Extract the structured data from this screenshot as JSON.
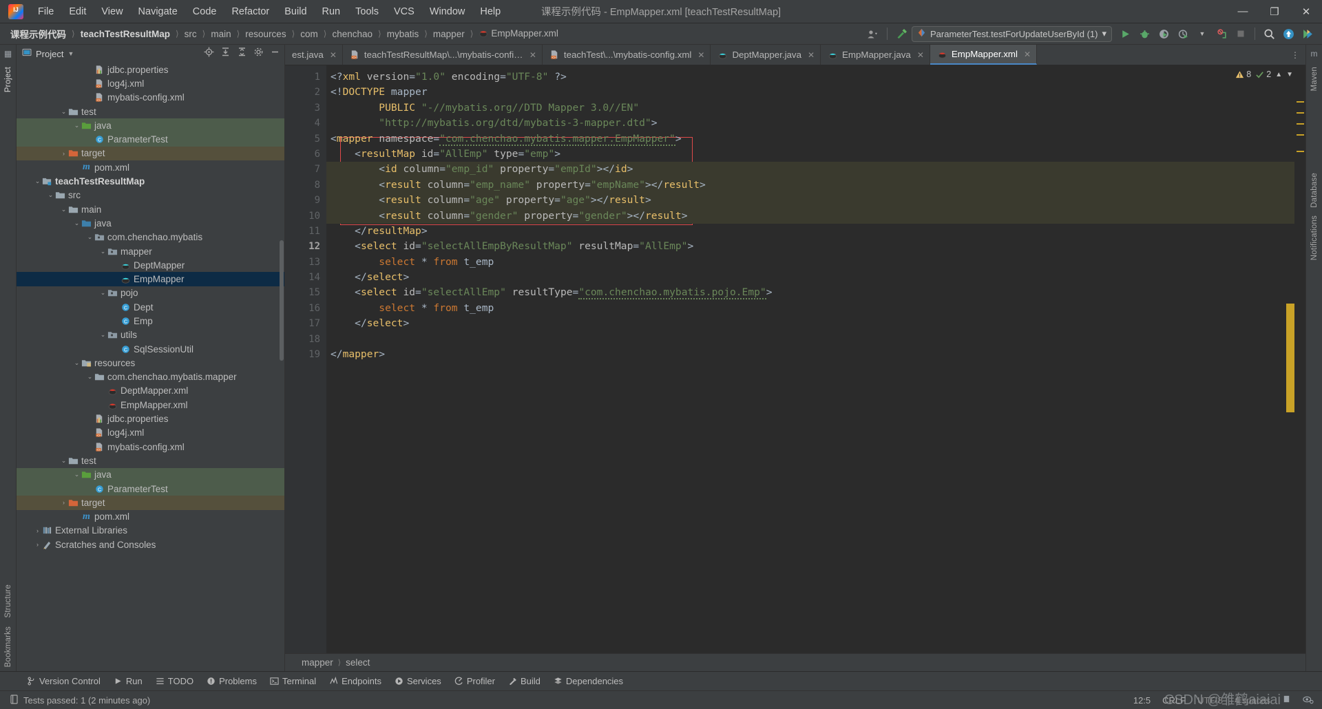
{
  "window": {
    "title": "课程示例代码 - EmpMapper.xml [teachTestResultMap]",
    "minimize": "—",
    "maximize": "❐",
    "close": "✕"
  },
  "menu": [
    "File",
    "Edit",
    "View",
    "Navigate",
    "Code",
    "Refactor",
    "Build",
    "Run",
    "Tools",
    "VCS",
    "Window",
    "Help"
  ],
  "breadcrumb": [
    "课程示例代码",
    "teachTestResultMap",
    "src",
    "main",
    "resources",
    "com",
    "chenchao",
    "mybatis",
    "mapper",
    "EmpMapper.xml"
  ],
  "toolbar": {
    "run_config": "ParameterTest.testForUpdateUserById (1)",
    "run_icon": "run-config-icon",
    "dropdown": "▾",
    "buttons": [
      "run-button",
      "debug-button",
      "run-coverage-button",
      "profiler-button",
      "stop-button",
      "search-button",
      "update-project-button",
      "ide-assistant-button"
    ],
    "avatar_icon": "user-avatar-icon",
    "hammer_icon": "build-hammer-icon"
  },
  "project_panel": {
    "title": "Project",
    "chevron": "▾",
    "actions": [
      "locate-in-tree-icon",
      "expand-all-icon",
      "collapse-all-icon",
      "settings-gear-icon",
      "hide-panel-icon"
    ]
  },
  "tree": [
    {
      "depth": 5,
      "label": "jdbc.properties",
      "icon": "properties-file-icon",
      "chev": "",
      "state": ""
    },
    {
      "depth": 5,
      "label": "log4j.xml",
      "icon": "xml-file-icon",
      "chev": "",
      "state": ""
    },
    {
      "depth": 5,
      "label": "mybatis-config.xml",
      "icon": "xml-file-icon",
      "chev": "",
      "state": ""
    },
    {
      "depth": 3,
      "label": "test",
      "icon": "folder-icon",
      "chev": "⌄",
      "state": ""
    },
    {
      "depth": 4,
      "label": "java",
      "icon": "folder-source-test-icon",
      "chev": "⌄",
      "state": "grn"
    },
    {
      "depth": 5,
      "label": "ParameterTest",
      "icon": "java-class-icon",
      "chev": "",
      "state": "grn"
    },
    {
      "depth": 3,
      "label": "target",
      "icon": "folder-excluded-icon",
      "chev": "›",
      "state": "brn"
    },
    {
      "depth": 4,
      "label": "pom.xml",
      "icon": "maven-icon",
      "chev": "",
      "state": ""
    },
    {
      "depth": 1,
      "label": "teachTestResultMap",
      "icon": "module-icon",
      "chev": "⌄",
      "state": "",
      "bold": true
    },
    {
      "depth": 2,
      "label": "src",
      "icon": "folder-icon",
      "chev": "⌄",
      "state": ""
    },
    {
      "depth": 3,
      "label": "main",
      "icon": "folder-icon",
      "chev": "⌄",
      "state": ""
    },
    {
      "depth": 4,
      "label": "java",
      "icon": "folder-source-icon",
      "chev": "⌄",
      "state": ""
    },
    {
      "depth": 5,
      "label": "com.chenchao.mybatis",
      "icon": "package-icon",
      "chev": "⌄",
      "state": ""
    },
    {
      "depth": 6,
      "label": "mapper",
      "icon": "package-icon",
      "chev": "⌄",
      "state": ""
    },
    {
      "depth": 7,
      "label": "DeptMapper",
      "icon": "java-interface-icon",
      "chev": "",
      "state": ""
    },
    {
      "depth": 7,
      "label": "EmpMapper",
      "icon": "java-interface-icon",
      "chev": "",
      "state": "sel"
    },
    {
      "depth": 6,
      "label": "pojo",
      "icon": "package-icon",
      "chev": "⌄",
      "state": ""
    },
    {
      "depth": 7,
      "label": "Dept",
      "icon": "java-class-icon",
      "chev": "",
      "state": ""
    },
    {
      "depth": 7,
      "label": "Emp",
      "icon": "java-class-icon",
      "chev": "",
      "state": ""
    },
    {
      "depth": 6,
      "label": "utils",
      "icon": "package-icon",
      "chev": "⌄",
      "state": ""
    },
    {
      "depth": 7,
      "label": "SqlSessionUtil",
      "icon": "java-class-icon",
      "chev": "",
      "state": ""
    },
    {
      "depth": 4,
      "label": "resources",
      "icon": "folder-resources-icon",
      "chev": "⌄",
      "state": ""
    },
    {
      "depth": 5,
      "label": "com.chenchao.mybatis.mapper",
      "icon": "folder-icon",
      "chev": "⌄",
      "state": ""
    },
    {
      "depth": 6,
      "label": "DeptMapper.xml",
      "icon": "mybatis-file-icon",
      "chev": "",
      "state": ""
    },
    {
      "depth": 6,
      "label": "EmpMapper.xml",
      "icon": "mybatis-file-icon",
      "chev": "",
      "state": ""
    },
    {
      "depth": 5,
      "label": "jdbc.properties",
      "icon": "properties-file-icon",
      "chev": "",
      "state": ""
    },
    {
      "depth": 5,
      "label": "log4j.xml",
      "icon": "xml-file-icon",
      "chev": "",
      "state": ""
    },
    {
      "depth": 5,
      "label": "mybatis-config.xml",
      "icon": "xml-file-icon",
      "chev": "",
      "state": ""
    },
    {
      "depth": 3,
      "label": "test",
      "icon": "folder-icon",
      "chev": "⌄",
      "state": ""
    },
    {
      "depth": 4,
      "label": "java",
      "icon": "folder-source-test-icon",
      "chev": "⌄",
      "state": "grn"
    },
    {
      "depth": 5,
      "label": "ParameterTest",
      "icon": "java-class-icon",
      "chev": "",
      "state": "grn"
    },
    {
      "depth": 3,
      "label": "target",
      "icon": "folder-excluded-icon",
      "chev": "›",
      "state": "brn"
    },
    {
      "depth": 4,
      "label": "pom.xml",
      "icon": "maven-icon",
      "chev": "",
      "state": ""
    },
    {
      "depth": 1,
      "label": "External Libraries",
      "icon": "libraries-icon",
      "chev": "›",
      "state": ""
    },
    {
      "depth": 1,
      "label": "Scratches and Consoles",
      "icon": "scratches-icon",
      "chev": "›",
      "state": ""
    }
  ],
  "tabs": [
    {
      "label": "est.java",
      "icon": "java-file-icon",
      "active": false,
      "clipped": true
    },
    {
      "label": "teachTestResultMap\\...\\mybatis-config.xml",
      "icon": "xml-file-icon",
      "active": false
    },
    {
      "label": "teachTest\\...\\mybatis-config.xml",
      "icon": "xml-file-icon",
      "active": false
    },
    {
      "label": "DeptMapper.java",
      "icon": "java-file-icon",
      "active": false
    },
    {
      "label": "EmpMapper.java",
      "icon": "java-file-icon",
      "active": false
    },
    {
      "label": "EmpMapper.xml",
      "icon": "mybatis-file-icon",
      "active": true
    }
  ],
  "inspections": {
    "warnings": "8",
    "weak_warnings": "2",
    "warning_icon": "warning-triangle-icon",
    "weak_icon": "weak-warning-icon",
    "up_arrow": "⌃",
    "down_arrow": "⌄"
  },
  "code_lines": [
    {
      "n": 1,
      "html": "<span class='punc'>&lt;?</span><span class='tag'>xml</span> <span class='attr'>version</span><span class='punc'>=</span><span class='val'>\"1.0\"</span> <span class='attr'>encoding</span><span class='punc'>=</span><span class='val'>\"UTF-8\"</span> <span class='punc'>?&gt;</span>"
    },
    {
      "n": 2,
      "html": "<span class='punc'>&lt;!</span><span class='dtd'>DOCTYPE</span> <span class='txt'>mapper</span>"
    },
    {
      "n": 3,
      "html": "        <span class='dtd'>PUBLIC</span> <span class='val'>\"-//mybatis.org//DTD Mapper 3.0//EN\"</span>"
    },
    {
      "n": 4,
      "html": "        <span class='val'>\"http://mybatis.org/dtd/mybatis-3-mapper.dtd\"</span><span class='punc'>&gt;</span>"
    },
    {
      "n": 5,
      "html": "<span class='punc'>&lt;</span><span class='tag'>mapper</span> <span class='attr'>namespace</span><span class='punc'>=</span><span class='val squig'>\"com.chenchao.mybatis.mapper.EmpMapper\"</span><span class='punc'>&gt;</span>"
    },
    {
      "n": 6,
      "html": "    <span class='punc'>&lt;</span><span class='tag'>resultMap</span> <span class='attr'>id</span><span class='punc'>=</span><span class='val'>\"AllEmp\"</span> <span class='attr'>type</span><span class='punc'>=</span><span class='val'>\"emp\"</span><span class='punc'>&gt;</span>"
    },
    {
      "n": 7,
      "html": "        <span class='punc'>&lt;</span><span class='tag'>id</span> <span class='attr'>column</span><span class='punc'>=</span><span class='val'>\"emp_id\"</span> <span class='attr'>property</span><span class='punc'>=</span><span class='val'>\"empId\"</span><span class='punc'>&gt;&lt;/</span><span class='tag'>id</span><span class='punc'>&gt;</span>",
      "hl": true
    },
    {
      "n": 8,
      "html": "        <span class='punc'>&lt;</span><span class='tag'>result</span> <span class='attr'>column</span><span class='punc'>=</span><span class='val'>\"emp_name\"</span> <span class='attr'>property</span><span class='punc'>=</span><span class='val'>\"empName\"</span><span class='punc'>&gt;&lt;/</span><span class='tag'>result</span><span class='punc'>&gt;</span>",
      "hl": true
    },
    {
      "n": 9,
      "html": "        <span class='punc'>&lt;</span><span class='tag'>result</span> <span class='attr'>column</span><span class='punc'>=</span><span class='val'>\"age\"</span> <span class='attr'>property</span><span class='punc'>=</span><span class='val'>\"age\"</span><span class='punc'>&gt;&lt;/</span><span class='tag'>result</span><span class='punc'>&gt;</span>",
      "hl": true
    },
    {
      "n": 10,
      "html": "        <span class='punc'>&lt;</span><span class='tag'>result</span> <span class='attr'>column</span><span class='punc'>=</span><span class='val'>\"gender\"</span> <span class='attr'>property</span><span class='punc'>=</span><span class='val'>\"gender\"</span><span class='punc'>&gt;&lt;/</span><span class='tag'>result</span><span class='punc'>&gt;</span>",
      "hl": true
    },
    {
      "n": 11,
      "html": "    <span class='punc'>&lt;/</span><span class='tag'>resultMap</span><span class='punc'>&gt;</span>"
    },
    {
      "n": 12,
      "html": "    <span class='punc'>&lt;</span><span class='tag'>select</span> <span class='attr'>id</span><span class='punc'>=</span><span class='val'>\"selectAllEmpByResultMap\"</span> <span class='attr'>resultMap</span><span class='punc'>=</span><span class='val'>\"AllEmp\"</span><span class='punc'>&gt;</span>"
    },
    {
      "n": 13,
      "html": "        <span class='kw'>select</span> <span class='punc'>*</span> <span class='kw'>from</span> <span class='txt'>t_emp</span>"
    },
    {
      "n": 14,
      "html": "    <span class='punc'>&lt;/</span><span class='tag'>select</span><span class='punc'>&gt;</span>"
    },
    {
      "n": 15,
      "html": "    <span class='punc'>&lt;</span><span class='tag'>select</span> <span class='attr'>id</span><span class='punc'>=</span><span class='val'>\"selectAllEmp\"</span> <span class='attr'>resultType</span><span class='punc'>=</span><span class='val squig'>\"com.chenchao.mybatis.pojo.Emp\"</span><span class='punc'>&gt;</span>"
    },
    {
      "n": 16,
      "html": "        <span class='kw'>select</span> <span class='punc'>*</span> <span class='kw'>from</span> <span class='txt'>t_emp</span>"
    },
    {
      "n": 17,
      "html": "    <span class='punc'>&lt;/</span><span class='tag'>select</span><span class='punc'>&gt;</span>"
    },
    {
      "n": 18,
      "html": ""
    },
    {
      "n": 19,
      "html": "<span class='punc'>&lt;/</span><span class='tag'>mapper</span><span class='punc'>&gt;</span>"
    }
  ],
  "editor_breadcrumb": [
    "mapper",
    "select"
  ],
  "tool_windows": [
    {
      "label": "Version Control",
      "icon": "branch-icon"
    },
    {
      "label": "Run",
      "icon": "run-icon"
    },
    {
      "label": "TODO",
      "icon": "todo-icon"
    },
    {
      "label": "Problems",
      "icon": "problems-icon"
    },
    {
      "label": "Terminal",
      "icon": "terminal-icon"
    },
    {
      "label": "Endpoints",
      "icon": "endpoints-icon"
    },
    {
      "label": "Services",
      "icon": "services-icon"
    },
    {
      "label": "Profiler",
      "icon": "profiler-icon"
    },
    {
      "label": "Build",
      "icon": "build-hammer-icon"
    },
    {
      "label": "Dependencies",
      "icon": "dependencies-icon"
    }
  ],
  "status": {
    "message": "Tests passed: 1 (2 minutes ago)",
    "message_icon": "test-status-icon",
    "caret": "12:5",
    "line_sep": "CRLF",
    "encoding": "UTF-8",
    "indent": "4 spaces",
    "lock_icon": "read-only-icon",
    "inspector_icon": "inspection-widget-icon",
    "watermark": "CSDN @雏鹤aiaiai"
  },
  "left_rail": {
    "top": [
      "Project"
    ],
    "bottom": [
      "Bookmarks",
      "Structure"
    ]
  },
  "right_rail": {
    "items": [
      "Maven",
      "Database",
      "Notifications"
    ]
  }
}
